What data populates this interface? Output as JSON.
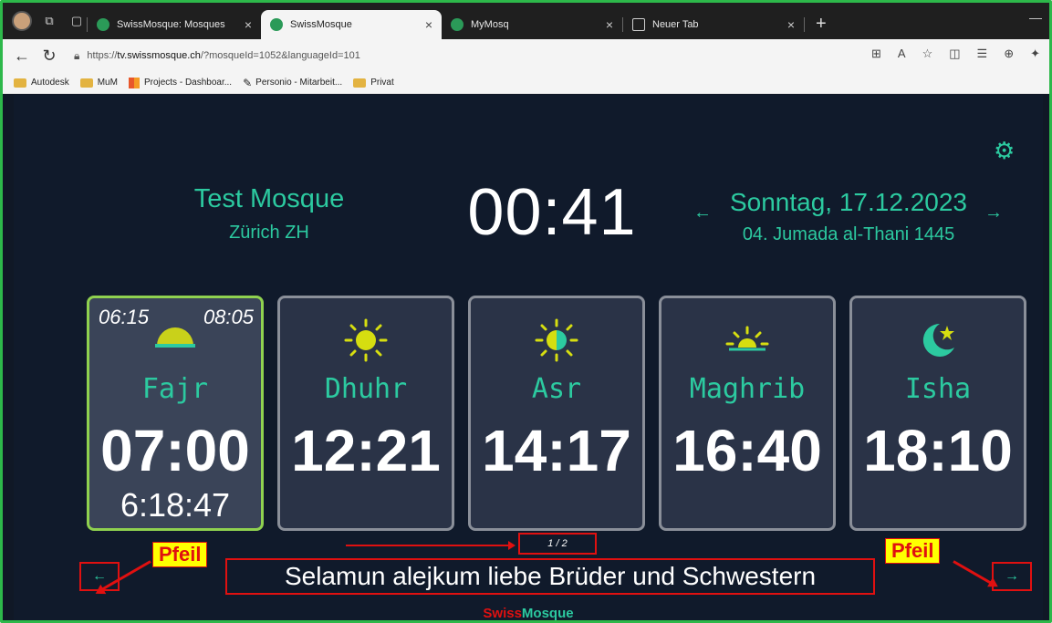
{
  "browser": {
    "tabs": [
      {
        "label": "SwissMosque: Mosques",
        "active": false
      },
      {
        "label": "SwissMosque",
        "active": true
      },
      {
        "label": "MyMosq",
        "active": false
      },
      {
        "label": "Neuer Tab",
        "active": false
      }
    ],
    "url_prefix": "https://",
    "url_host": "tv.swissmosque.ch",
    "url_path": "/?mosqueId=1052&languageId=101",
    "bookmarks": [
      "Autodesk",
      "MuM",
      "Projects - Dashboar...",
      "Personio - Mitarbeit...",
      "Privat"
    ]
  },
  "header": {
    "mosque_name": "Test Mosque",
    "mosque_city": "Zürich ZH",
    "clock": "00:41",
    "date_gregorian": "Sonntag, 17.12.2023",
    "date_hijri": "04. Jumada al-Thani 1445"
  },
  "prayers": [
    {
      "name": "Fajr",
      "time": "07:00",
      "countdown": "6:18:47",
      "sunrise": "06:15",
      "sunset_end": "08:05",
      "icon": "sunrise-icon",
      "active": true
    },
    {
      "name": "Dhuhr",
      "time": "12:21",
      "icon": "sun-icon",
      "active": false
    },
    {
      "name": "Asr",
      "time": "14:17",
      "icon": "half-sun-icon",
      "active": false
    },
    {
      "name": "Maghrib",
      "time": "16:40",
      "icon": "sunset-icon",
      "active": false
    },
    {
      "name": "Isha",
      "time": "18:10",
      "icon": "moon-star-icon",
      "active": false
    }
  ],
  "pager": "1 / 2",
  "marquee_text": "Selamun alejkum liebe Brüder und Schwestern",
  "annotations": {
    "left": "Pfeil",
    "right": "Pfeil"
  },
  "brand": {
    "part1": "Swiss",
    "part2": "Mosque"
  },
  "colors": {
    "accent": "#2ccaa0",
    "background": "#101a2b",
    "active_border": "#8fd14f",
    "annotation": "#e01010"
  }
}
